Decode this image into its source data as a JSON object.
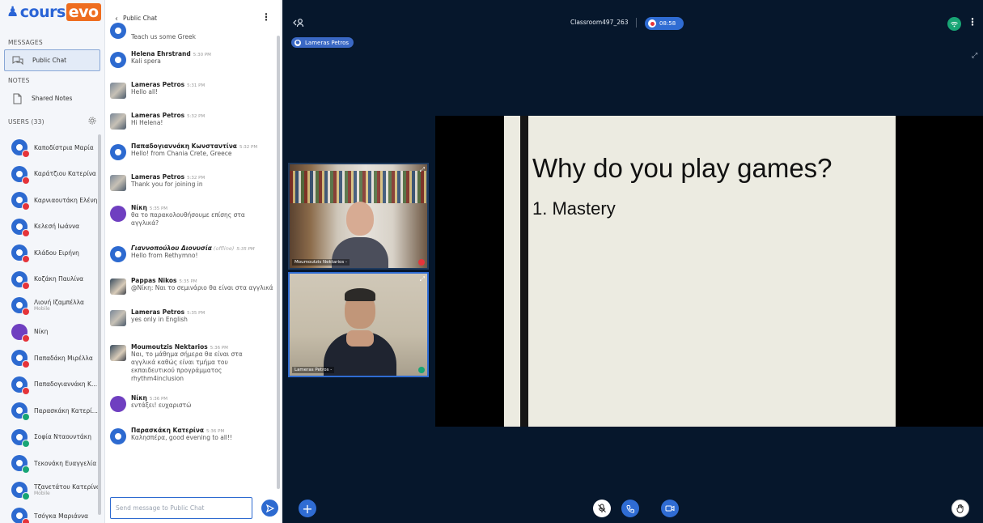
{
  "brand": {
    "logo_a": "cours",
    "logo_b": "evo"
  },
  "sidebar": {
    "messages_title": "MESSAGES",
    "public_chat_label": "Public Chat",
    "notes_title": "NOTES",
    "shared_notes_label": "Shared Notes",
    "users_title": "USERS (33)",
    "users": [
      {
        "name": "Καποδίστρια Μαρία",
        "sub": ""
      },
      {
        "name": "Καράτζιου Κατερίνα",
        "sub": ""
      },
      {
        "name": "Καρνιαουτάκη Ελένη",
        "sub": ""
      },
      {
        "name": "Κελεσή Ιωάννα",
        "sub": ""
      },
      {
        "name": "Κλάδου Ειρήνη",
        "sub": ""
      },
      {
        "name": "Κοζάκη Παυλίνα",
        "sub": ""
      },
      {
        "name": "Λιονή Ιζαμπέλλα",
        "sub": "Mobile"
      },
      {
        "name": "Νίκη",
        "sub": ""
      },
      {
        "name": "Παπαδάκη Μιρέλλα",
        "sub": ""
      },
      {
        "name": "Παπαδογιαννάκη Κ...",
        "sub": ""
      },
      {
        "name": "Παρασκάκη Κατερί...",
        "sub": ""
      },
      {
        "name": "Σοφία Νταουντάκη",
        "sub": ""
      },
      {
        "name": "Τεκονάκη Ευαγγελία",
        "sub": ""
      },
      {
        "name": "Τζανετάτου Κατερίνα",
        "sub": "Mobile"
      },
      {
        "name": "Τσόγκα Μαριάννα",
        "sub": ""
      }
    ]
  },
  "chat": {
    "header": "Public Chat",
    "messages": [
      {
        "name": "Helena Ehrstrand",
        "time": "",
        "off": "",
        "text": "Teach us some Greek"
      },
      {
        "name": "Helena Ehrstrand",
        "time": "5:30 PM",
        "off": "",
        "text": "Kali spera"
      },
      {
        "name": "Lameras Petros",
        "time": "5:31 PM",
        "off": "",
        "text": "Hello all!"
      },
      {
        "name": "Lameras Petros",
        "time": "5:32 PM",
        "off": "",
        "text": "Hi Helena!"
      },
      {
        "name": "Παπαδογιαννάκη Κωνσταντίνα",
        "time": "5:32 PM",
        "off": "",
        "text": "Hello! from Chania Crete, Greece"
      },
      {
        "name": "Lameras Petros",
        "time": "5:32 PM",
        "off": "",
        "text": "Thank you for joining in"
      },
      {
        "name": "Νίκη",
        "time": "5:35 PM",
        "off": "",
        "text": "θα το παρακολουθήσουμε επίσης στα αγγλικά?"
      },
      {
        "name": "Γιαννοπούλου Διονυσία",
        "time": "5:35 PM",
        "off": "(offline)",
        "text": "Hello from Rethymno!"
      },
      {
        "name": "Pappas Nikos",
        "time": "5:35 PM",
        "off": "",
        "text": "@Νίκη: Ναι το σεμινάριο θα είναι στα αγγλικά"
      },
      {
        "name": "Lameras Petros",
        "time": "5:35 PM",
        "off": "",
        "text": "yes only in English"
      },
      {
        "name": "Moumoutzis Nektarios",
        "time": "5:36 PM",
        "off": "",
        "text": "Ναι, το μάθημα σήμερα θα είναι στα αγγλικά καθώς είναι τμήμα του εκπαιδευτικού προγράμματος rhythm4inclusion"
      },
      {
        "name": "Νίκη",
        "time": "5:36 PM",
        "off": "",
        "text": "εντάξει! ευχαριστώ"
      },
      {
        "name": "Παρασκάκη Κατερίνα",
        "time": "5:36 PM",
        "off": "",
        "text": "Καλησπέρα, good evening to all!!"
      }
    ],
    "input_placeholder": "Send message to Public Chat"
  },
  "room": {
    "title": "Classroom497_263",
    "recording_time": "08:58",
    "presenter": "Lameras Petros"
  },
  "videos": [
    {
      "label": "Moumoutzis Nektarios -"
    },
    {
      "label": "Lameras Petros -"
    }
  ],
  "slide": {
    "title": "Why do you play games?",
    "item": "1.  Mastery"
  },
  "colors": {
    "accent": "#2f6cd3",
    "main_bg": "#06172c",
    "brand_orange": "#ee6d1f",
    "online": "#18a575",
    "muted": "#e5343a"
  }
}
